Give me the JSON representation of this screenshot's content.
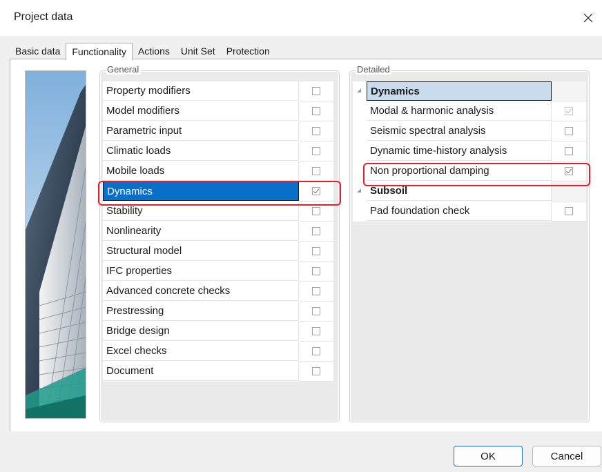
{
  "window": {
    "title": "Project data"
  },
  "tabs": [
    {
      "label": "Basic data",
      "active": false
    },
    {
      "label": "Functionality",
      "active": true
    },
    {
      "label": "Actions",
      "active": false
    },
    {
      "label": "Unit Set",
      "active": false
    },
    {
      "label": "Protection",
      "active": false
    }
  ],
  "general": {
    "label": "General",
    "items": [
      {
        "label": "Property modifiers",
        "checked": false
      },
      {
        "label": "Model modifiers",
        "checked": false
      },
      {
        "label": "Parametric input",
        "checked": false
      },
      {
        "label": "Climatic loads",
        "checked": false
      },
      {
        "label": "Mobile loads",
        "checked": false
      },
      {
        "label": "Dynamics",
        "checked": true,
        "selected": true
      },
      {
        "label": "Stability",
        "checked": false
      },
      {
        "label": "Nonlinearity",
        "checked": false
      },
      {
        "label": "Structural model",
        "checked": false
      },
      {
        "label": "IFC properties",
        "checked": false
      },
      {
        "label": "Advanced concrete checks",
        "checked": false
      },
      {
        "label": "Prestressing",
        "checked": false
      },
      {
        "label": "Bridge design",
        "checked": false
      },
      {
        "label": "Excel checks",
        "checked": false
      },
      {
        "label": "Document",
        "checked": false
      }
    ]
  },
  "detailed": {
    "label": "Detailed",
    "sections": [
      {
        "title": "Dynamics",
        "items": [
          {
            "label": "Modal & harmonic analysis",
            "checked": true,
            "disabled": true
          },
          {
            "label": "Seismic spectral analysis",
            "checked": false
          },
          {
            "label": "Dynamic time-history analysis",
            "checked": false
          },
          {
            "label": "Non proportional damping",
            "checked": true
          }
        ]
      },
      {
        "title": "Subsoil",
        "items": [
          {
            "label": "Pad foundation check",
            "checked": false
          }
        ]
      }
    ]
  },
  "buttons": {
    "ok": "OK",
    "cancel": "Cancel"
  },
  "colors": {
    "selection": "#0a6fc8",
    "highlight": "#e0202e"
  }
}
